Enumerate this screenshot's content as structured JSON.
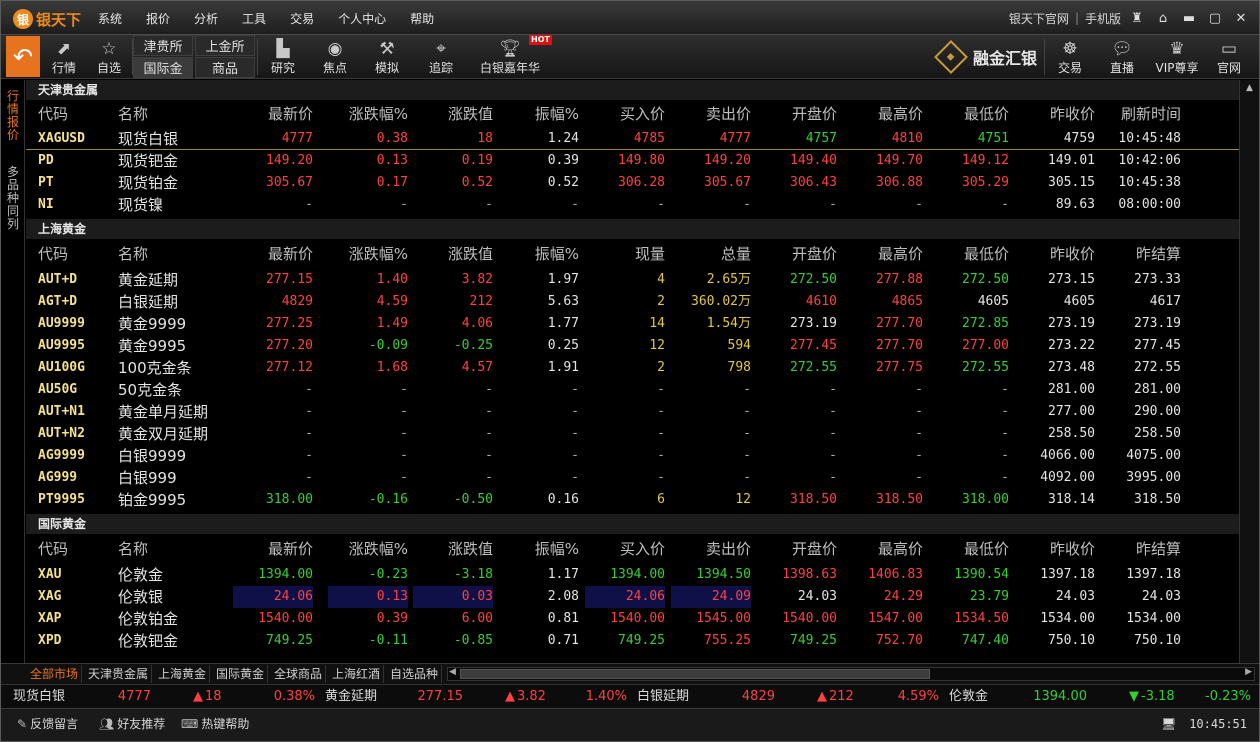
{
  "app": {
    "brand": "银天下",
    "coin": "银"
  },
  "menu": [
    "系统",
    "报价",
    "分析",
    "工具",
    "交易",
    "个人中心",
    "帮助"
  ],
  "title_right": {
    "official": "银天下官网",
    "mobile": "手机版",
    "sep": "|"
  },
  "toolbar": {
    "back_icon": "↶",
    "items": [
      {
        "label": "行情",
        "icon": "chart-icon"
      },
      {
        "label": "自选",
        "icon": "star-icon"
      },
      {
        "label": "研究",
        "icon": "bar-chart-icon"
      },
      {
        "label": "焦点",
        "icon": "radar-icon"
      },
      {
        "label": "模拟",
        "icon": "hammer-icon"
      },
      {
        "label": "追踪",
        "icon": "location-pin-icon"
      },
      {
        "label": "白银嘉年华",
        "icon": "trophy-icon"
      }
    ],
    "markets": [
      "津贵所",
      "上金所",
      "国际金",
      "商品"
    ],
    "hot": "HOT",
    "rongjin": "融金汇银",
    "right_items": [
      {
        "label": "交易",
        "icon": "helm-icon"
      },
      {
        "label": "直播",
        "icon": "chat-icon"
      },
      {
        "label": "VIP尊享",
        "icon": "vip-chair-icon"
      },
      {
        "label": "官网",
        "icon": "monitor-icon"
      }
    ]
  },
  "left_tabs": {
    "quote": "行情报价",
    "multi": "多品种同列"
  },
  "tianjin": {
    "title": "天津贵金属",
    "headers": [
      "代码",
      "名称",
      "最新价",
      "涨跌幅%",
      "涨跌值",
      "振幅%",
      "买入价",
      "卖出价",
      "开盘价",
      "最高价",
      "最低价",
      "昨收价",
      "刷新时间"
    ],
    "rows": [
      [
        "XAGUSD",
        "现货白银",
        "4777",
        "0.38",
        "18",
        "1.24",
        "4785",
        "4777",
        "4757",
        "4810",
        "4751",
        "4759",
        "10:45:48"
      ],
      [
        "PD",
        "现货钯金",
        "149.20",
        "0.13",
        "0.19",
        "0.39",
        "149.80",
        "149.20",
        "149.40",
        "149.70",
        "149.12",
        "149.01",
        "10:42:06"
      ],
      [
        "PT",
        "现货铂金",
        "305.67",
        "0.17",
        "0.52",
        "0.52",
        "306.28",
        "305.67",
        "306.43",
        "306.88",
        "305.29",
        "305.15",
        "10:45:38"
      ],
      [
        "NI",
        "现货镍",
        "-",
        "-",
        "-",
        "-",
        "-",
        "-",
        "-",
        "-",
        "-",
        "89.63",
        "08:00:00"
      ]
    ]
  },
  "shanghai": {
    "title": "上海黄金",
    "headers": [
      "代码",
      "名称",
      "最新价",
      "涨跌幅%",
      "涨跌值",
      "振幅%",
      "现量",
      "总量",
      "开盘价",
      "最高价",
      "最低价",
      "昨收价",
      "昨结算"
    ],
    "rows": [
      [
        "AUT+D",
        "黄金延期",
        "277.15",
        "1.40",
        "3.82",
        "1.97",
        "4",
        "2.65万",
        "272.50",
        "277.88",
        "272.50",
        "273.15",
        "273.33"
      ],
      [
        "AGT+D",
        "白银延期",
        "4829",
        "4.59",
        "212",
        "5.63",
        "2",
        "360.02万",
        "4610",
        "4865",
        "4605",
        "4605",
        "4617"
      ],
      [
        "AU9999",
        "黄金9999",
        "277.25",
        "1.49",
        "4.06",
        "1.77",
        "14",
        "1.54万",
        "273.19",
        "277.70",
        "272.85",
        "273.19",
        "273.19"
      ],
      [
        "AU9995",
        "黄金9995",
        "277.20",
        "-0.09",
        "-0.25",
        "0.25",
        "12",
        "594",
        "277.45",
        "277.70",
        "277.00",
        "273.22",
        "277.45"
      ],
      [
        "AU100G",
        "100克金条",
        "277.12",
        "1.68",
        "4.57",
        "1.91",
        "2",
        "798",
        "272.55",
        "277.75",
        "272.55",
        "273.48",
        "272.55"
      ],
      [
        "AU50G",
        "50克金条",
        "-",
        "-",
        "-",
        "-",
        "-",
        "-",
        "-",
        "-",
        "-",
        "281.00",
        "281.00"
      ],
      [
        "AUT+N1",
        "黄金单月延期",
        "-",
        "-",
        "-",
        "-",
        "-",
        "-",
        "-",
        "-",
        "-",
        "277.00",
        "290.00"
      ],
      [
        "AUT+N2",
        "黄金双月延期",
        "-",
        "-",
        "-",
        "-",
        "-",
        "-",
        "-",
        "-",
        "-",
        "258.50",
        "258.50"
      ],
      [
        "AG9999",
        "白银9999",
        "-",
        "-",
        "-",
        "-",
        "-",
        "-",
        "-",
        "-",
        "-",
        "4066.00",
        "4075.00"
      ],
      [
        "AG999",
        "白银999",
        "-",
        "-",
        "-",
        "-",
        "-",
        "-",
        "-",
        "-",
        "-",
        "4092.00",
        "3995.00"
      ],
      [
        "PT9995",
        "铂金9995",
        "318.00",
        "-0.16",
        "-0.50",
        "0.16",
        "6",
        "12",
        "318.50",
        "318.50",
        "318.00",
        "318.14",
        "318.50"
      ]
    ]
  },
  "intl": {
    "title": "国际黄金",
    "headers": [
      "代码",
      "名称",
      "最新价",
      "涨跌幅%",
      "涨跌值",
      "振幅%",
      "买入价",
      "卖出价",
      "开盘价",
      "最高价",
      "最低价",
      "昨收价",
      "昨结算"
    ],
    "rows": [
      [
        "XAU",
        "伦敦金",
        "1394.00",
        "-0.23",
        "-3.18",
        "1.17",
        "1394.00",
        "1394.50",
        "1398.63",
        "1406.83",
        "1390.54",
        "1397.18",
        "1397.18"
      ],
      [
        "XAG",
        "伦敦银",
        "24.06",
        "0.13",
        "0.03",
        "2.08",
        "24.06",
        "24.09",
        "24.03",
        "24.29",
        "23.79",
        "24.03",
        "24.03"
      ],
      [
        "XAP",
        "伦敦铂金",
        "1540.00",
        "0.39",
        "6.00",
        "0.81",
        "1540.00",
        "1545.00",
        "1540.00",
        "1547.00",
        "1534.50",
        "1534.00",
        "1534.00"
      ],
      [
        "XPD",
        "伦敦钯金",
        "749.25",
        "-0.11",
        "-0.85",
        "0.71",
        "749.25",
        "755.25",
        "749.25",
        "752.70",
        "747.40",
        "750.10",
        "750.10"
      ]
    ]
  },
  "bottom_tabs": [
    "全部市场",
    "天津贵金属",
    "上海黄金",
    "国际黄金",
    "全球商品",
    "上海红酒",
    "自选品种"
  ],
  "ticker": [
    {
      "name": "现货白银",
      "price": "4777",
      "change": "18",
      "pct": "0.38%",
      "dir": "up"
    },
    {
      "name": "黄金延期",
      "price": "277.15",
      "change": "3.82",
      "pct": "1.40%",
      "dir": "up"
    },
    {
      "name": "白银延期",
      "price": "4829",
      "change": "212",
      "pct": "4.59%",
      "dir": "up"
    },
    {
      "name": "伦敦金",
      "price": "1394.00",
      "change": "-3.18",
      "pct": "-0.23%",
      "dir": "down"
    }
  ],
  "status": {
    "feedback": "反馈留言",
    "recommend": "好友推荐",
    "hotkey": "热键帮助",
    "time": "10:45:51"
  },
  "colors": {
    "up": "#ff4040",
    "down": "#33d033",
    "flat": "#e4e4e4",
    "accent": "#e8731f",
    "volume": "#e5c740"
  }
}
